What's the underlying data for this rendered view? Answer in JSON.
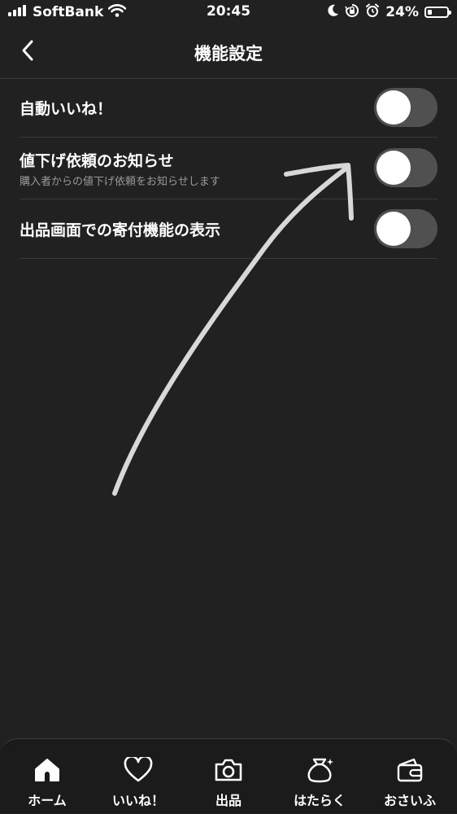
{
  "status_bar": {
    "carrier": "SoftBank",
    "time": "20:45",
    "battery_percent": "24%",
    "battery_level": 0.24,
    "icons": [
      "signal-icon",
      "wifi-icon",
      "moon-icon",
      "orientation-lock-icon",
      "alarm-icon",
      "battery-icon"
    ]
  },
  "nav": {
    "title": "機能設定",
    "back_icon": "chevron-left-icon"
  },
  "settings": [
    {
      "label": "自動いいね！",
      "subtitle": "",
      "enabled": false
    },
    {
      "label": "値下げ依頼のお知らせ",
      "subtitle": "購入者からの値下げ依頼をお知らせします",
      "enabled": false
    },
    {
      "label": "出品画面での寄付機能の表示",
      "subtitle": "",
      "enabled": false
    }
  ],
  "annotation": {
    "type": "hand-drawn-arrow",
    "color": "#e0e0e0"
  },
  "tab_bar": {
    "tabs": [
      {
        "label": "ホーム",
        "icon": "home-icon"
      },
      {
        "label": "いいね！",
        "icon": "heart-icon"
      },
      {
        "label": "出品",
        "icon": "camera-icon"
      },
      {
        "label": "はたらく",
        "icon": "money-bag-icon"
      },
      {
        "label": "おさいふ",
        "icon": "wallet-icon"
      }
    ]
  },
  "colors": {
    "background": "#212121",
    "toggle_off": "#505050",
    "divider": "#3a3a3a",
    "subtitle": "#9a9a9a"
  }
}
